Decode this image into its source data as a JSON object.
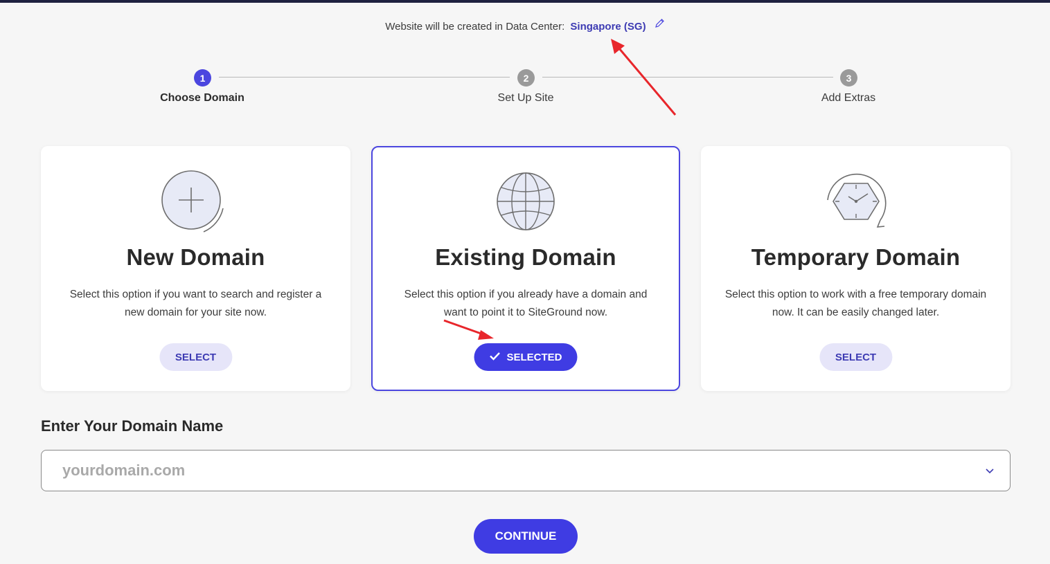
{
  "datacenter": {
    "prefix": "Website will be created in Data Center:",
    "value": "Singapore (SG)"
  },
  "steps": [
    {
      "number": "1",
      "label": "Choose Domain",
      "active": true
    },
    {
      "number": "2",
      "label": "Set Up Site",
      "active": false
    },
    {
      "number": "3",
      "label": "Add Extras",
      "active": false
    }
  ],
  "cards": [
    {
      "icon": "plus-circle-icon",
      "title": "New Domain",
      "description": "Select this option if you want to search and register a new domain for your site now.",
      "button": "SELECT",
      "selected": false
    },
    {
      "icon": "globe-icon",
      "title": "Existing Domain",
      "description": "Select this option if you already have a domain and want to point it to SiteGround now.",
      "button": "SELECTED",
      "selected": true
    },
    {
      "icon": "clock-icon",
      "title": "Temporary Domain",
      "description": "Select this option to work with a free temporary domain now. It can be easily changed later.",
      "button": "SELECT",
      "selected": false
    }
  ],
  "domain_section": {
    "heading": "Enter Your Domain Name",
    "placeholder": "yourdomain.com",
    "value": ""
  },
  "continue_label": "CONTINUE",
  "colors": {
    "accent": "#3f3ce3",
    "accent_light": "#e6e5f9",
    "annotation_arrow": "#e8262b"
  }
}
